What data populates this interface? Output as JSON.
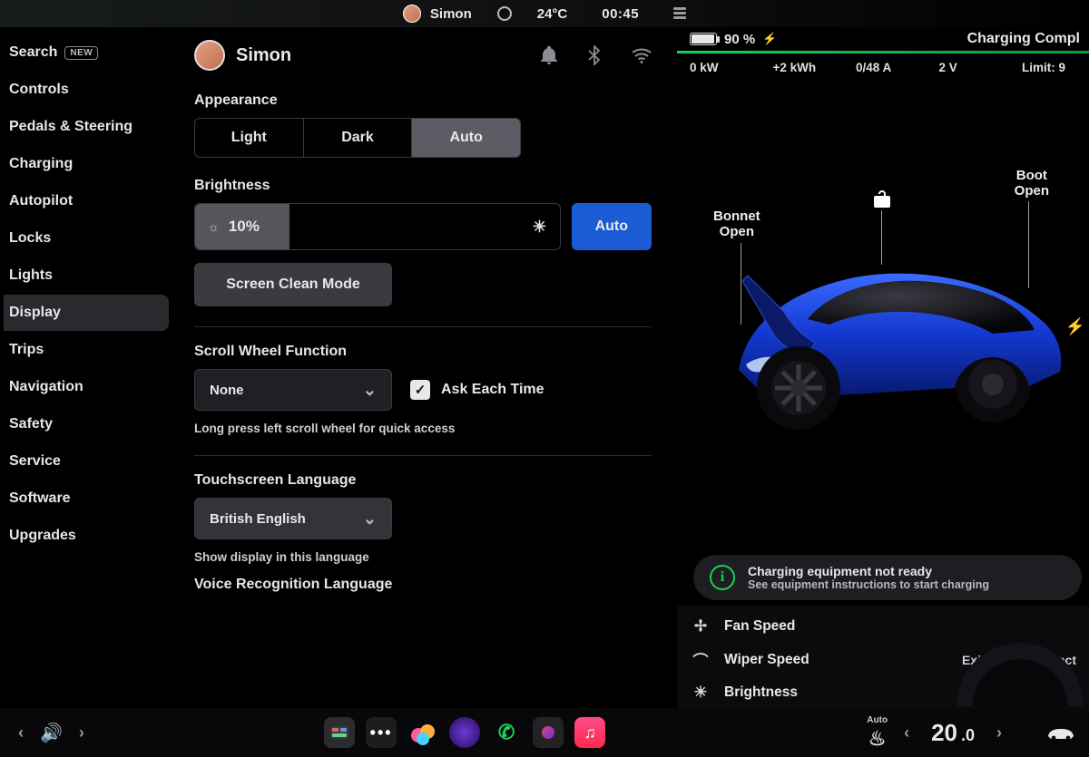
{
  "status": {
    "userName": "Simon",
    "temperature": "24°C",
    "time": "00:45"
  },
  "sidebar": {
    "items": [
      {
        "label": "Search",
        "badge": "NEW"
      },
      {
        "label": "Controls"
      },
      {
        "label": "Pedals & Steering"
      },
      {
        "label": "Charging"
      },
      {
        "label": "Autopilot"
      },
      {
        "label": "Locks"
      },
      {
        "label": "Lights"
      },
      {
        "label": "Display",
        "active": true
      },
      {
        "label": "Trips"
      },
      {
        "label": "Navigation"
      },
      {
        "label": "Safety"
      },
      {
        "label": "Service"
      },
      {
        "label": "Software"
      },
      {
        "label": "Upgrades"
      }
    ]
  },
  "profile": {
    "name": "Simon"
  },
  "appearance": {
    "heading": "Appearance",
    "options": [
      "Light",
      "Dark",
      "Auto"
    ],
    "selected": "Auto"
  },
  "brightness": {
    "heading": "Brightness",
    "value": "10%",
    "autoLabel": "Auto"
  },
  "screenClean": "Screen Clean Mode",
  "scroll": {
    "heading": "Scroll Wheel Function",
    "value": "None",
    "askLabel": "Ask Each Time",
    "askChecked": true,
    "hint": "Long press left scroll wheel for quick access"
  },
  "touchLang": {
    "heading": "Touchscreen Language",
    "value": "British English",
    "hint": "Show display in this language"
  },
  "voiceLang": {
    "heading": "Voice Recognition Language"
  },
  "charging": {
    "batteryPercent": "90 %",
    "status": "Charging Compl",
    "stats": [
      {
        "label": "0 kW"
      },
      {
        "label": "+2 kWh"
      },
      {
        "label": "0/48 A"
      },
      {
        "label": "2 V"
      },
      {
        "label": "Limit: 9"
      }
    ],
    "bonnet": "Bonnet\nOpen",
    "boot": "Boot\nOpen",
    "notice": {
      "title": "Charging equipment not ready",
      "sub": "See equipment instructions to start charging"
    }
  },
  "quick": {
    "rows": [
      {
        "icon": "fan",
        "label": "Fan Speed"
      },
      {
        "icon": "wiper",
        "label": "Wiper Speed",
        "exit": "Exit ›",
        "select": "› Select"
      },
      {
        "icon": "bright",
        "label": "Brightness"
      }
    ]
  },
  "dock": {
    "seatMode": "Auto",
    "tempWhole": "20",
    "tempFrac": ".0"
  }
}
